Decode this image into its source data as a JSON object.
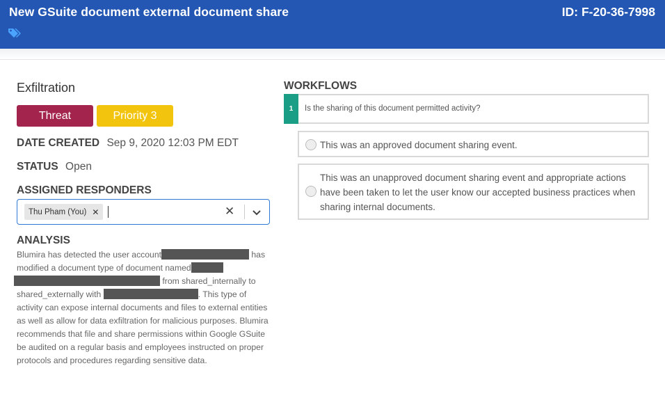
{
  "header": {
    "title": "New GSuite document external document share",
    "id": "ID: F-20-36-7998",
    "icon": "tag-icon"
  },
  "finding": {
    "category": "Exfiltration",
    "type_badge": "Threat",
    "priority_badge": "Priority 3",
    "date_created_label": "DATE CREATED",
    "date_created_value": "Sep 9, 2020 12:03 PM EDT",
    "status_label": "STATUS",
    "status_value": "Open",
    "assigned_label": "ASSIGNED RESPONDERS",
    "responders": [
      "Thu Pham (You)"
    ],
    "analysis_label": "ANALYSIS",
    "analysis": {
      "p1": "Blumira has detected the user account",
      "p2": "has modified a document type of document named",
      "p3": "from shared_internally to",
      "p4": "shared_externally with",
      "p5": ". This type of activity can expose internal documents and files to external entities as well as allow for data exfiltration for malicious purposes. Blumira recommends that file and share permissions within Google GSuite be audited on a regular basis and employees instructed on proper protocols and procedures regarding sensitive data."
    }
  },
  "workflows": {
    "label": "WORKFLOWS",
    "step_number": "1",
    "question": "Is the sharing of this document permitted activity?",
    "options": [
      "This was an approved document sharing event.",
      "This was an unapproved document sharing event and appropriate actions have been taken to let the user know our accepted business practices when sharing internal documents."
    ]
  },
  "colors": {
    "header": "#2357b3",
    "threat": "#a3254d",
    "priority": "#f2c40d",
    "step": "#1b9e86",
    "focus": "#2f7ad6"
  }
}
